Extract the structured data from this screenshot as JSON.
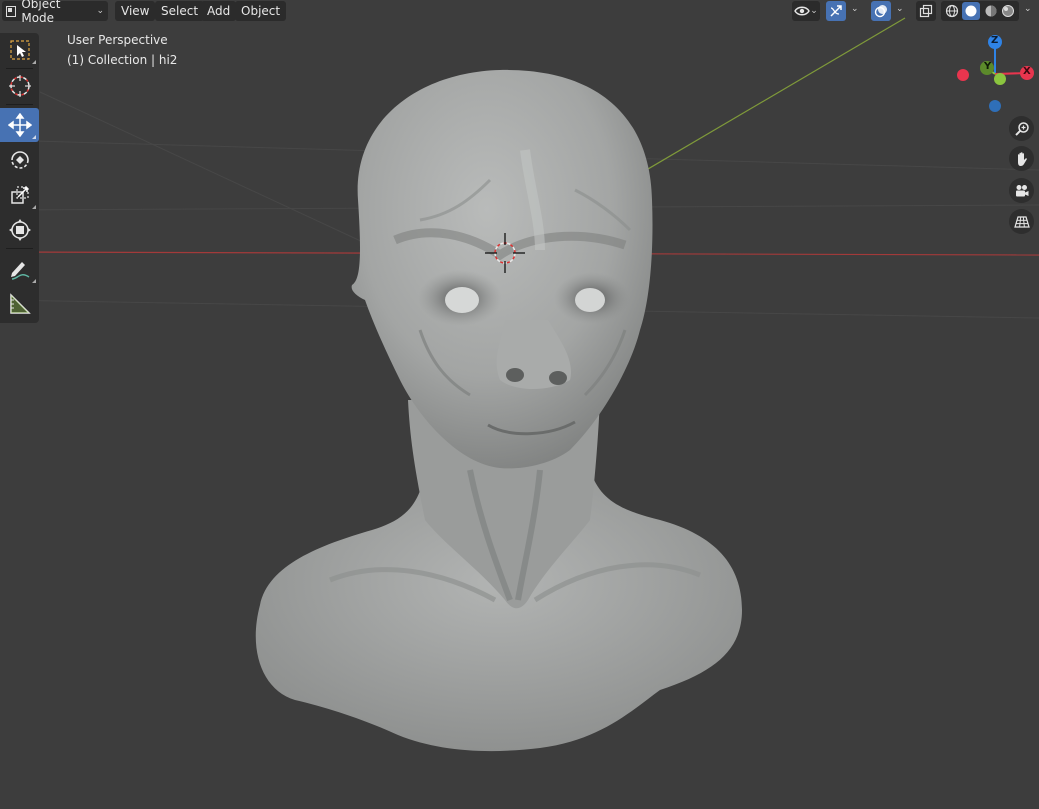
{
  "header": {
    "mode_label": "Object Mode",
    "menu": [
      "View",
      "Select",
      "Add",
      "Object"
    ]
  },
  "overlay": {
    "perspective_label": "User Perspective",
    "collection_label": "(1) Collection | hi2"
  },
  "toolbar": {
    "tools": [
      {
        "name": "select-box",
        "active": false
      },
      {
        "name": "cursor",
        "active": false
      },
      {
        "name": "move",
        "active": true
      },
      {
        "name": "rotate",
        "active": false
      },
      {
        "name": "scale",
        "active": false
      },
      {
        "name": "transform",
        "active": false
      },
      {
        "name": "annotate",
        "active": false
      },
      {
        "name": "measure",
        "active": false
      }
    ]
  },
  "gizmo": {
    "x_label": "X",
    "y_label": "Y",
    "z_label": "Z",
    "colors": {
      "x": "#e8354e",
      "y": "#8bc53f",
      "z": "#2f83e6"
    }
  },
  "colors": {
    "accent": "#4772b3",
    "background": "#3d3d3d",
    "x_axis_line": "#a33a3a",
    "y_axis_line": "#7f9a3a",
    "model": "#a8aaa9"
  },
  "shading": {
    "active_mode": "solid"
  }
}
